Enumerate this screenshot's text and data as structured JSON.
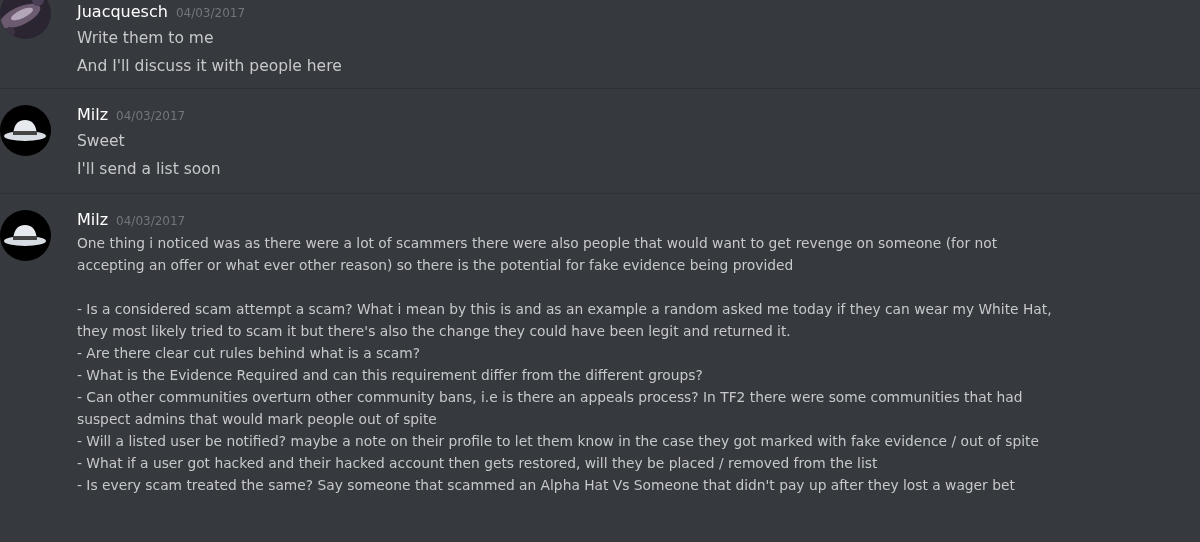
{
  "messages": [
    {
      "author": "Juacquesch",
      "timestamp": "04/03/2017",
      "kind": "picture",
      "paragraphs": [
        [
          "Write them to me",
          "And I'll discuss it with people here"
        ]
      ]
    },
    {
      "author": "Milz",
      "timestamp": "04/03/2017",
      "kind": "hat",
      "paragraphs": [
        [
          "Sweet",
          "I'll send a list soon"
        ]
      ]
    },
    {
      "author": "Milz",
      "timestamp": "04/03/2017",
      "kind": "hat",
      "paragraphs": [
        [
          "One thing i noticed was as there were a lot of scammers there were also people that would want to get revenge on someone (for not",
          "accepting an offer or what ever other reason) so there is the potential for fake evidence being provided"
        ],
        [
          "- Is a considered scam attempt a scam? What i mean by this is and as an example a random asked me today if they can wear my White Hat,",
          "they most likely tried to scam it but there's also the change they could have been legit and returned it.",
          "- Are there clear cut rules behind what is a scam?",
          "- What is the Evidence Required and can this requirement differ from the different groups?",
          "- Can other communities overturn other community bans, i.e is there an appeals process? In TF2 there were some communities that had",
          "suspect admins that would mark people out of spite",
          "- Will a listed user be notified? maybe a note on their profile to let them know in the case they got marked with fake evidence / out of spite",
          "- What if a user got hacked and their hacked account then gets restored, will they be placed / removed from the list",
          "- Is every scam treated the same? Say someone that scammed an Alpha Hat Vs Someone that didn't pay up after they lost a wager bet"
        ]
      ]
    }
  ]
}
